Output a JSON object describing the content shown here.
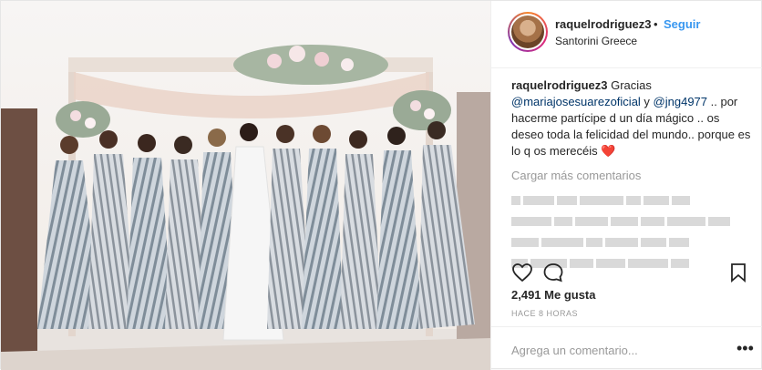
{
  "post": {
    "username": "raquelrodriguez3",
    "follow_label": "Seguir",
    "separator": "•",
    "location": "Santorini Greece",
    "caption": {
      "username": "raquelrodriguez3",
      "text_before": " Gracias ",
      "mention_1": "@mariajosesuarezoficial",
      "text_middle": " y ",
      "mention_2": "@jng4977",
      "text_after": " .. por hacerme partícipe d un día mágico .. os deseo toda la felicidad del mundo.. porque es lo q os merecéis ",
      "emoji": "❤️"
    },
    "load_more_label": "Cargar más comentarios",
    "likes_label": "2,491 Me gusta",
    "timestamp": "HACE 8 HORAS",
    "comment_placeholder": "Agrega un comentario...",
    "more_label": "•••"
  },
  "icons": {
    "avatar": "avatar",
    "like": "heart-icon",
    "comment": "comment-icon",
    "save": "bookmark-icon",
    "more": "more-icon"
  },
  "colors": {
    "follow": "#3897f0",
    "mention": "#003569",
    "muted": "#999999",
    "border": "#efefef",
    "heart": "#ed1c24"
  }
}
